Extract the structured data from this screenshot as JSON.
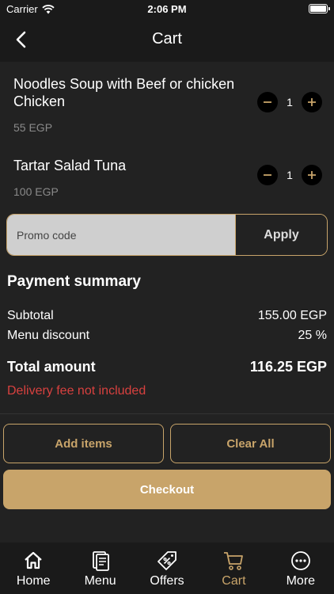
{
  "status_bar": {
    "carrier": "Carrier",
    "time": "2:06 PM"
  },
  "nav": {
    "title": "Cart"
  },
  "cart": {
    "items": [
      {
        "name": "Noodles Soup with Beef or chicken Chicken",
        "price": "55 EGP",
        "qty": "1"
      },
      {
        "name": "Tartar Salad Tuna",
        "price": "100 EGP",
        "qty": "1"
      }
    ]
  },
  "promo": {
    "placeholder": "Promo code",
    "apply_label": "Apply"
  },
  "summary": {
    "title": "Payment summary",
    "subtotal_label": "Subtotal",
    "subtotal_value": "155.00 EGP",
    "discount_label": "Menu discount",
    "discount_value": "25 %",
    "total_label": "Total amount",
    "total_value": "116.25 EGP",
    "delivery_note": "Delivery fee not included"
  },
  "actions": {
    "add_items": "Add items",
    "clear_all": "Clear All",
    "checkout": "Checkout"
  },
  "tabs": [
    {
      "label": "Home",
      "icon": "home-icon"
    },
    {
      "label": "Menu",
      "icon": "menu-book-icon"
    },
    {
      "label": "Offers",
      "icon": "offers-tag-icon"
    },
    {
      "label": "Cart",
      "icon": "cart-icon"
    },
    {
      "label": "More",
      "icon": "more-icon"
    }
  ],
  "active_tab": "Cart",
  "colors": {
    "accent": "#c8a46a",
    "background": "#222222",
    "bar": "#1a1a1a",
    "danger": "#d8413f"
  }
}
